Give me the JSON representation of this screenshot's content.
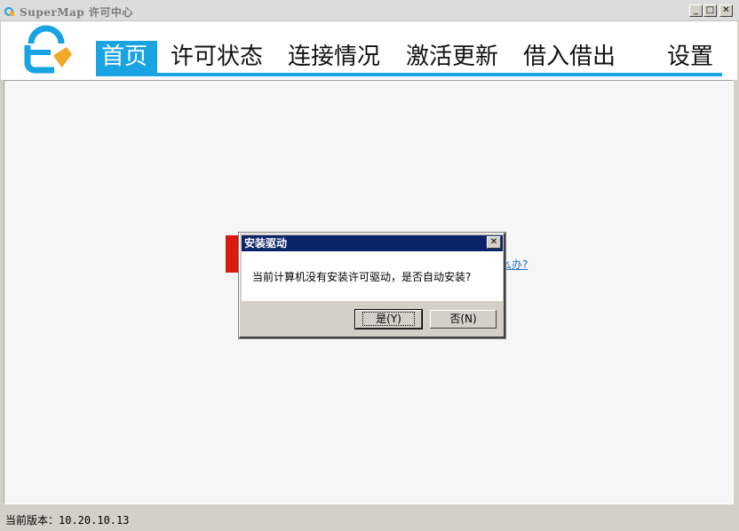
{
  "window": {
    "title": "SuperMap 许可中心",
    "minimize_glyph": "_",
    "maximize_glyph": "□",
    "close_glyph": "✕"
  },
  "nav": {
    "items": [
      {
        "label": "首页",
        "active": true
      },
      {
        "label": "许可状态",
        "active": false
      },
      {
        "label": "连接情况",
        "active": false
      },
      {
        "label": "激活更新",
        "active": false
      },
      {
        "label": "借入借出",
        "active": false
      },
      {
        "label": "设置",
        "active": false
      }
    ],
    "accent_color": "#19a3e3"
  },
  "content": {
    "help_link_partial": "么办?"
  },
  "status_bar": {
    "version_text": "当前版本：10.20.10.13"
  },
  "dialog": {
    "title": "安装驱动",
    "message": "当前计算机没有安装许可驱动，是否自动安装?",
    "yes_label": "是(Y)",
    "no_label": "否(N)",
    "close_glyph": "✕"
  },
  "icons": {
    "app": "supermap-lock-icon",
    "logo": "license-lock-icon"
  }
}
